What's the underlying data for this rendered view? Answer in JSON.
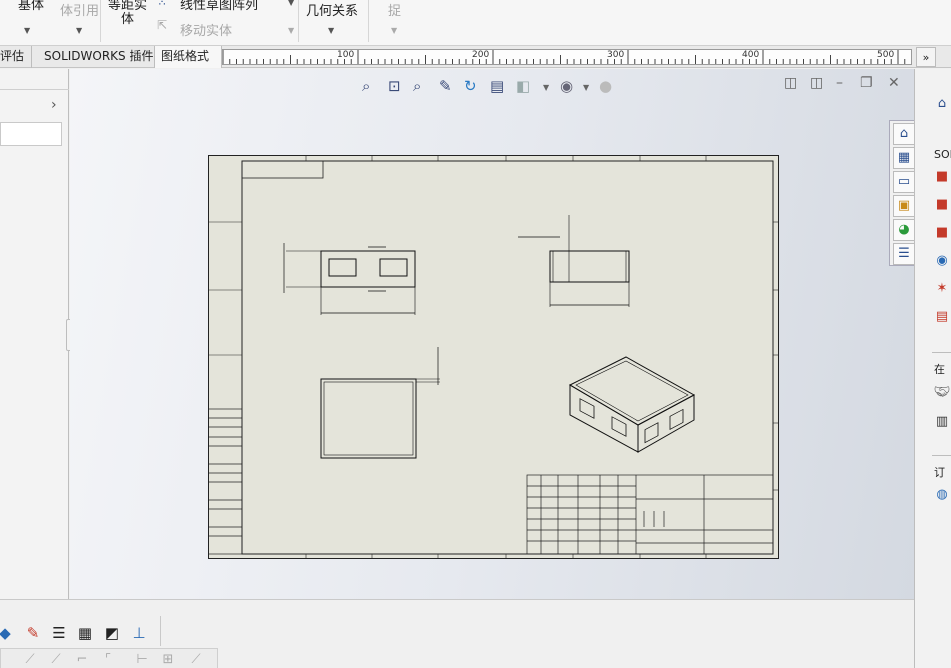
{
  "ribbon": {
    "items": [
      {
        "label": "基体",
        "disabled": false
      },
      {
        "label": "体引用",
        "disabled": true
      },
      {
        "label": "等距实",
        "disabled": false
      },
      {
        "label": "体",
        "disabled": false
      },
      {
        "label": "线性草图阵列",
        "disabled": false
      },
      {
        "label": "移动实体",
        "disabled": true
      },
      {
        "label": "几何关系",
        "disabled": false
      },
      {
        "label": "捉",
        "disabled": true
      }
    ]
  },
  "tabs": [
    {
      "label": "评估"
    },
    {
      "label": "SOLIDWORKS 插件"
    },
    {
      "label": "图纸格式"
    }
  ],
  "ruler": {
    "labels": [
      "100",
      "200",
      "300",
      "400",
      "500"
    ],
    "expand_icon": "double-chevron-right-icon"
  },
  "heads_up_toolbar": [
    "zoom-to-fit-icon",
    "zoom-area-icon",
    "zoom-previous-icon",
    "pan-icon",
    "rotate-icon",
    "view-orientation-icon",
    "display-style-icon",
    "hide-show-icon",
    "appearance-icon"
  ],
  "window_controls": [
    "tile-left-icon",
    "tile-right-icon",
    "minimize-icon",
    "restore-icon",
    "close-icon"
  ],
  "task_pane": {
    "tabs": [
      "home-icon",
      "3d-parts-icon",
      "file-explorer-icon",
      "view-palette-icon",
      "appearances-icon",
      "custom-properties-icon"
    ],
    "labels": [
      "SOL",
      "在",
      "订"
    ]
  },
  "drawing": {
    "sheet_color": "#e4e4da",
    "background_color": "#ffffff",
    "line_color": "#1a1a1a"
  },
  "accent_color": "#c43a2a"
}
